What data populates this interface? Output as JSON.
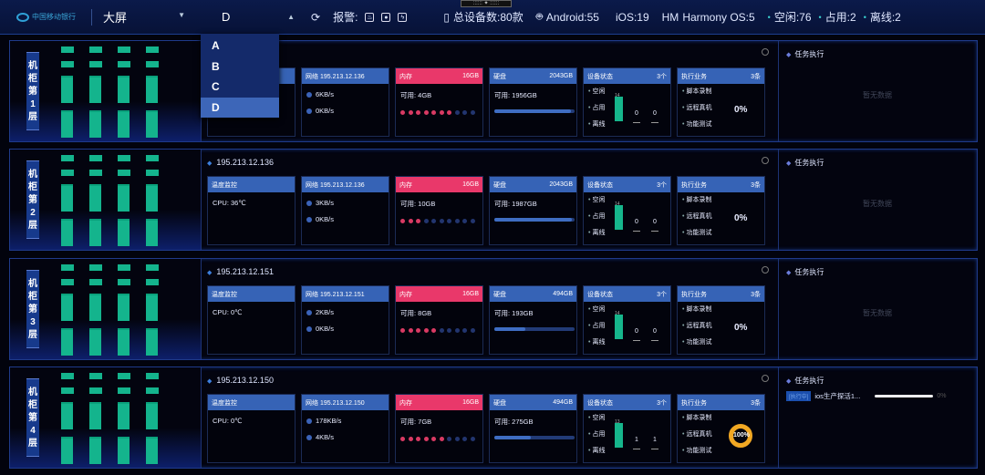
{
  "header": {
    "logo": "中国移动银行",
    "screen_select": "大屏",
    "cabinet_select": "D",
    "alarm_label": "报警:",
    "alarm_icons": [
      "fire-icon",
      "water-icon",
      "power-icon"
    ],
    "total_devices": "总设备数:80款",
    "android": "Android:55",
    "ios": "iOS:19",
    "harmony_icon": "HM",
    "harmony": "Harmony OS:5",
    "idle": "空闲:76",
    "occupied": "占用:2",
    "offline": "离线:2"
  },
  "dropdown": {
    "options": [
      "A",
      "B",
      "C",
      "D"
    ],
    "selected": "D"
  },
  "labels": {
    "temp": "温度监控",
    "net": "网络",
    "mem": "内存",
    "disk": "硬盘",
    "status": "设备状态",
    "status_count": "3个",
    "biz": "执行业务",
    "biz_count": "3条",
    "avail": "可用: ",
    "idle": "空闲",
    "occupied": "占用",
    "offline": "离线",
    "script": "脚本录制",
    "remote": "远程真机",
    "func": "功能测试",
    "task": "任务执行",
    "empty": "暂无数据"
  },
  "colors": {
    "slot_ok": "#14b48d",
    "slot_alarm": "#e9375f",
    "slot_busy": "#4a72c4",
    "header_blue": "#3663b6",
    "mem_pink": "#e9386a"
  },
  "rows": [
    {
      "cabinet": "机柜第1层",
      "ip": "195.213.12.136",
      "cpu": "",
      "net_ip": "195.213.12.136",
      "up": "6KB/s",
      "down": "0KB/s",
      "mem_total": "16GB",
      "mem_avail": "4GB",
      "mem_used_dots": 7,
      "disk_total": "2043GB",
      "disk_avail": "1956GB",
      "disk_avail_pct": 96,
      "idle_count": "14",
      "occupied": "0",
      "offline": "0",
      "biz_pct": "0%",
      "slots": [
        [
          "ok",
          "ok",
          "ok",
          "ok"
        ],
        [
          "ok",
          "ok",
          "ok",
          "ok"
        ],
        [
          "ok",
          "ok",
          "ok",
          "ok"
        ],
        [
          "ok",
          "ok",
          "ok",
          "ok"
        ]
      ],
      "task": null
    },
    {
      "cabinet": "机柜第2层",
      "ip": "195.213.12.136",
      "cpu": "CPU: 36℃",
      "net_ip": "195.213.12.136",
      "up": "3KB/s",
      "down": "0KB/s",
      "mem_total": "16GB",
      "mem_avail": "10GB",
      "mem_used_dots": 3,
      "disk_total": "2043GB",
      "disk_avail": "1987GB",
      "disk_avail_pct": 97,
      "idle_count": "14",
      "occupied": "0",
      "offline": "0",
      "biz_pct": "0%",
      "slots": [
        [
          "ok",
          "ok",
          "ok",
          "ok"
        ],
        [
          "ok",
          "ok",
          "ok",
          "ok"
        ],
        [
          "ok",
          "ok",
          "ok",
          "ok"
        ],
        [
          "empty",
          "empty",
          "ok",
          "ok"
        ]
      ],
      "task": null
    },
    {
      "cabinet": "机柜第3层",
      "ip": "195.213.12.151",
      "cpu": "CPU: 0℃",
      "net_ip": "195.213.12.151",
      "up": "2KB/s",
      "down": "0KB/s",
      "mem_total": "16GB",
      "mem_avail": "8GB",
      "mem_used_dots": 5,
      "disk_total": "494GB",
      "disk_avail": "193GB",
      "disk_avail_pct": 39,
      "idle_count": "14",
      "occupied": "0",
      "offline": "0",
      "biz_pct": "0%",
      "slots": [
        [
          "ok",
          "ok",
          "ok",
          "ok"
        ],
        [
          "ok",
          "ok",
          "ok",
          "ok"
        ],
        [
          "ok",
          "ok",
          "ok",
          "ok"
        ],
        [
          "alarm",
          "ok",
          "ok",
          "ok"
        ]
      ],
      "task": null
    },
    {
      "cabinet": "机柜第4层",
      "ip": "195.213.12.150",
      "cpu": "CPU: 0℃",
      "net_ip": "195.213.12.150",
      "up": "178KB/s",
      "down": "4KB/s",
      "mem_total": "16GB",
      "mem_avail": "7GB",
      "mem_used_dots": 6,
      "disk_total": "494GB",
      "disk_avail": "275GB",
      "disk_avail_pct": 45,
      "idle_count": "13",
      "occupied": "1",
      "offline": "1",
      "biz_pct": "100%",
      "slots": [
        [
          "ok",
          "ok",
          "ok",
          "ok"
        ],
        [
          "ok",
          "ok",
          "ok",
          "busy"
        ],
        [
          "ok",
          "ok",
          "ok",
          "ok"
        ],
        [
          "ok",
          "ok",
          "ok",
          "ok"
        ]
      ],
      "task": {
        "badge": "[执行中]",
        "name": "ios生产探活1...",
        "progress": "0%"
      }
    }
  ]
}
